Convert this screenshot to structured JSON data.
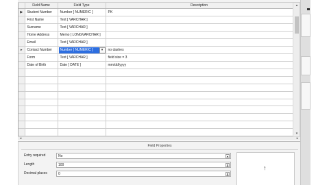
{
  "grid": {
    "headers": [
      "Field Name",
      "Field Type",
      "Description"
    ],
    "rows": [
      {
        "name": "Student Number",
        "type": "Number [ NUMERIC ]",
        "desc": "PK"
      },
      {
        "name": "First Name",
        "type": "Text [ VARCHAR ]",
        "desc": ""
      },
      {
        "name": "Surname",
        "type": "Text [ VARCHAR ]",
        "desc": ""
      },
      {
        "name": "Home Address",
        "type": "Memo [ LONGVARCHAR ]",
        "desc": ""
      },
      {
        "name": "Email",
        "type": "Text [ VARCHAR ]",
        "desc": ""
      },
      {
        "name": "Contact Number",
        "type": "Number [ NUMERIC ]",
        "desc": "no dashes"
      },
      {
        "name": "Form",
        "type": "Text [ VARCHAR ]",
        "desc": "field size = 3"
      },
      {
        "name": "Date of Birth",
        "type": "Date [ DATE ]",
        "desc": "mm/dd/yyyy"
      }
    ],
    "current_row_marker": "▶",
    "edit_row_marker": "▸",
    "dropdown_arrow": "▾"
  },
  "props": {
    "title": "Field Properties",
    "rows": [
      {
        "label": "Entry required",
        "value": "No",
        "control": "dropdown"
      },
      {
        "label": "Length",
        "value": "100",
        "control": "spin"
      },
      {
        "label": "Decimal places",
        "value": "0",
        "control": "spin"
      }
    ],
    "help_icon": "up-arrow-icon",
    "help_glyph": "↑"
  },
  "icons": {
    "scroll_up": "▴",
    "scroll_down": "▾",
    "scroll_left": "◂",
    "scroll_right": "▸",
    "spin": "⬍"
  },
  "colors": {
    "selection": "#2d6ee0",
    "header_bg": "#f0f0f0",
    "panel_bg": "#f3f3f3"
  }
}
